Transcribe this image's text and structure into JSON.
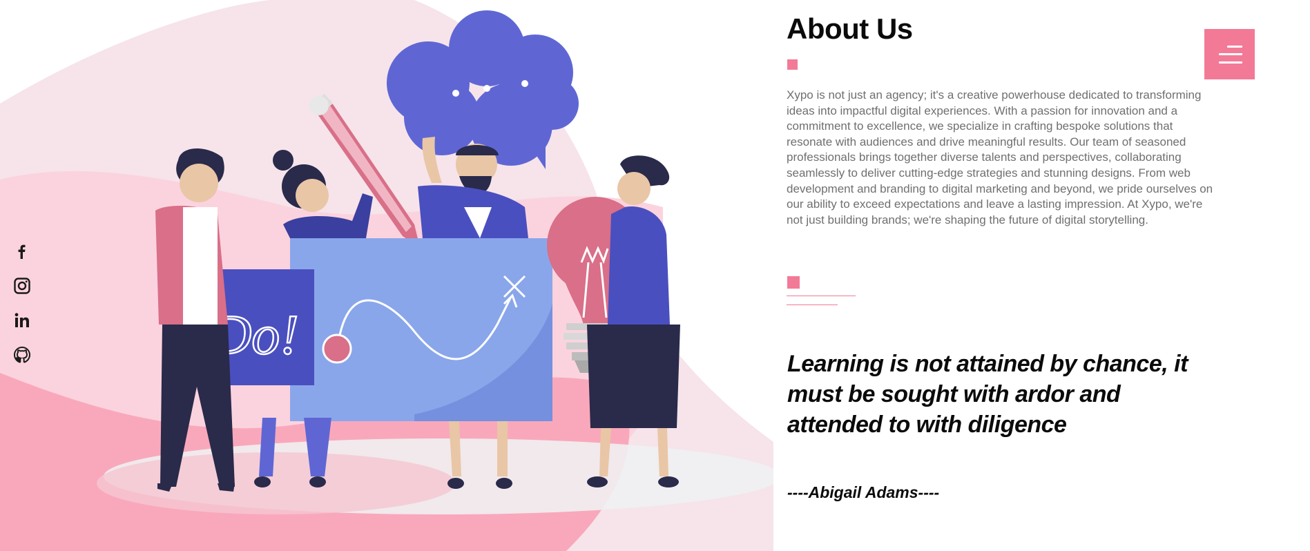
{
  "social": {
    "items": [
      {
        "name": "facebook-icon",
        "label": "f"
      },
      {
        "name": "instagram-icon",
        "label": "instagram"
      },
      {
        "name": "linkedin-icon",
        "label": "in"
      },
      {
        "name": "github-icon",
        "label": "github"
      }
    ]
  },
  "illustration": {
    "do_text": "Do!"
  },
  "menu": {
    "icon": "hamburger-menu-icon"
  },
  "about": {
    "title": "About Us",
    "description": "Xypo is not just an agency; it's a creative powerhouse dedicated to transforming ideas into impactful digital experiences. With a passion for innovation and a commitment to excellence, we specialize in crafting bespoke solutions that resonate with audiences and drive meaningful results. Our team of seasoned professionals brings together diverse talents and perspectives, collaborating seamlessly to deliver cutting-edge strategies and stunning designs. From web development and branding to digital marketing and beyond, we pride ourselves on our ability to exceed expectations and leave a lasting impression. At Xypo, we're not just building brands; we're shaping the future of digital storytelling.",
    "quote": "Learning is not attained by chance, it must be sought with ardor and attended to with diligence",
    "author": "----Abigail Adams----"
  },
  "colors": {
    "accent": "#f27a96",
    "text": "#0b0b0b",
    "muted": "#6f6f6f",
    "purple": "#5f66d4",
    "navy": "#2a2a4a"
  }
}
